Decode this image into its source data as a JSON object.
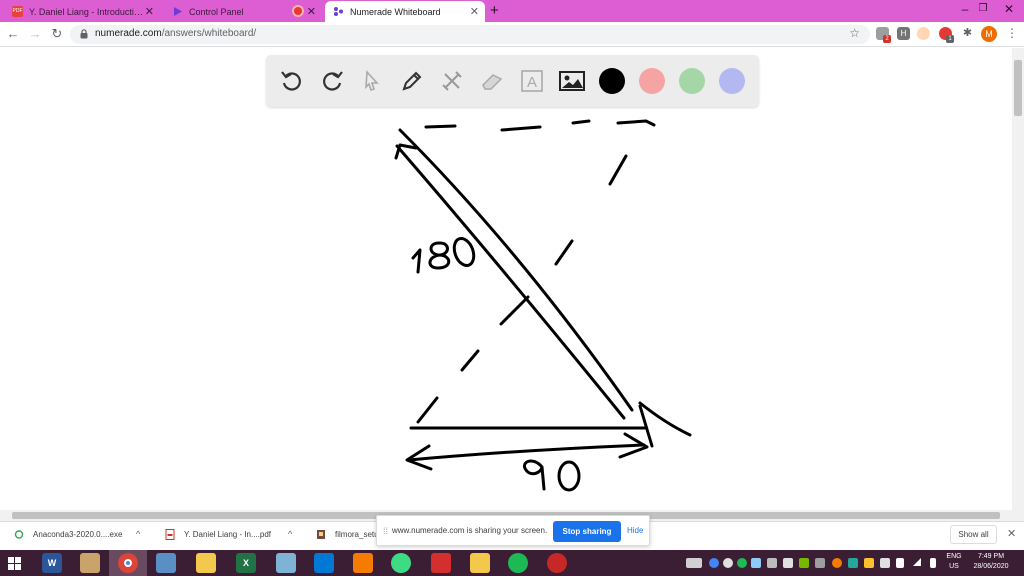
{
  "browser": {
    "tabs": [
      {
        "label": "Y. Daniel Liang - Introduction to",
        "favicon_text": "PDF"
      },
      {
        "label": "Control Panel"
      },
      {
        "label": "Numerade Whiteboard",
        "active": true
      }
    ],
    "url_host": "numerade.com",
    "url_path": "/answers/whiteboard/",
    "profile_initial": "M",
    "extension_badge": "2",
    "extension_badge_2": "1"
  },
  "whiteboard": {
    "tools": [
      "undo-icon",
      "redo-icon",
      "pointer-icon",
      "pen-icon",
      "tools-icon",
      "eraser-icon",
      "text-box-icon",
      "image-icon"
    ],
    "text_tool_glyph": "A",
    "colors": [
      "#000000",
      "#f5a3a3",
      "#a5d6a7",
      "#b3b8f0"
    ],
    "handwriting": {
      "label_hypotenuse": "180",
      "label_base": "90"
    }
  },
  "downloads": [
    {
      "name": "Anaconda3-2020.0....exe"
    },
    {
      "name": "Y. Daniel Liang - In....pdf"
    },
    {
      "name": "filmora_setu"
    }
  ],
  "share_banner": {
    "text": "www.numerade.com is sharing your screen.",
    "stop_label": "Stop sharing",
    "hide_label": "Hide"
  },
  "show_all_label": "Show all",
  "taskbar": {
    "lang_top": "ENG",
    "lang_bottom": "US",
    "time": "7:49 PM",
    "date": "28/06/2020",
    "app_labels": {
      "word": "W",
      "excel": "X"
    }
  }
}
